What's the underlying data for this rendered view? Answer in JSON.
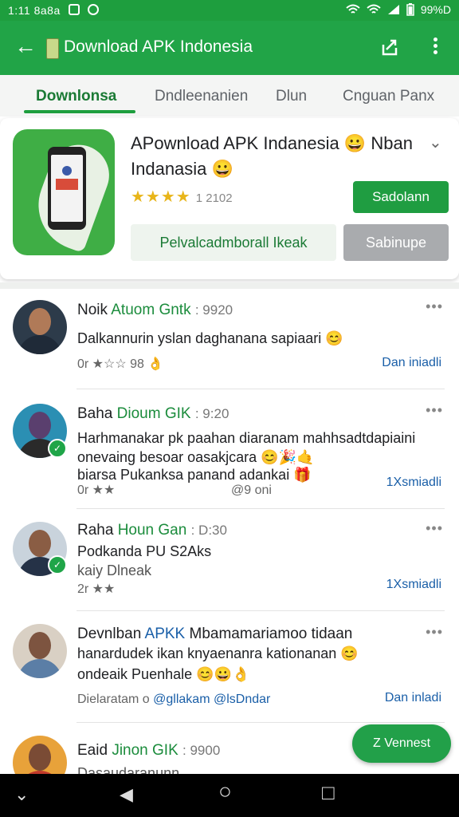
{
  "status_bar": {
    "time": "1:11 8a8a",
    "battery": "99%D",
    "icons": [
      "wifi-icon",
      "signal-icon",
      "battery-icon"
    ]
  },
  "app_bar": {
    "title": "Download APK Indonesia"
  },
  "tabs": [
    {
      "label": "Downlonsa",
      "active": true
    },
    {
      "label": "Dndleenanien",
      "active": false
    },
    {
      "label": "Dlun",
      "active": false
    },
    {
      "label": "Cnguan Panx",
      "active": false
    }
  ],
  "app_card": {
    "title": "APownload APK Indanesia 😀 Nban Indanasia 😀",
    "rating_stars": 4,
    "rating_count": "1 2102",
    "primary_button": "Sadolann",
    "secondary_button": "Pelvalcadmborall Ikeak",
    "tertiary_button": "Sabinupe"
  },
  "posts": [
    {
      "name": "Noik",
      "handle": "Atuom Gntk",
      "meta": ": 9920",
      "lines": [
        "Dalkannurin yslan daghanana sapiaari 😊"
      ],
      "foot": "0r ★☆☆ 98 👌",
      "mid": "",
      "link": "Dan iniadli",
      "verified": false
    },
    {
      "name": "Baha",
      "handle": "Dioum GIK",
      "meta": ": 9:20",
      "lines": [
        "Harhmanakar pk paahan diaranam mahhsadtdapiaini",
        "onevaing besoar oasakjcara 😊🎉🤙",
        "biarsa Pukanksa panand adankai 🎁"
      ],
      "foot": "0r ★★",
      "mid": "@9 oni",
      "link": "1Xsmiadli",
      "verified": true
    },
    {
      "name": "Raha",
      "handle": "Houn Gan",
      "meta": ": D:30",
      "lines": [
        "Podkanda PU S2Aks",
        "kaiy Dlneak"
      ],
      "foot": "2r ★★",
      "mid": "",
      "link": "1Xsmiadli",
      "verified": true
    },
    {
      "name": "Devnlban",
      "handle": "APKK",
      "meta": "Mbamamariamoo tidaan",
      "lines": [
        "hanardudek ikan knyaenanra kationanan 😊",
        "ondeaik Puenhale 😊😀👌"
      ],
      "foot": "Dielaratam o",
      "handles": "@gllakam @lsDndar",
      "mid": "",
      "link": "Dan inladi",
      "verified": false
    },
    {
      "name": "Eaid",
      "handle": "Jinon GIK",
      "meta": ": 9900",
      "lines": [
        "Dasaudaranunn"
      ],
      "foot": "",
      "mid": "",
      "link": "",
      "verified": false
    }
  ],
  "fab": {
    "label": "Z Vennest"
  },
  "nav_bar": {
    "down": "⌄",
    "back": "◀",
    "home": "○",
    "recent": "□"
  },
  "colors": {
    "primary": "#21a447",
    "accent_dark": "#1b7a35",
    "link": "#1a5fa8",
    "star": "#e8b51a"
  }
}
